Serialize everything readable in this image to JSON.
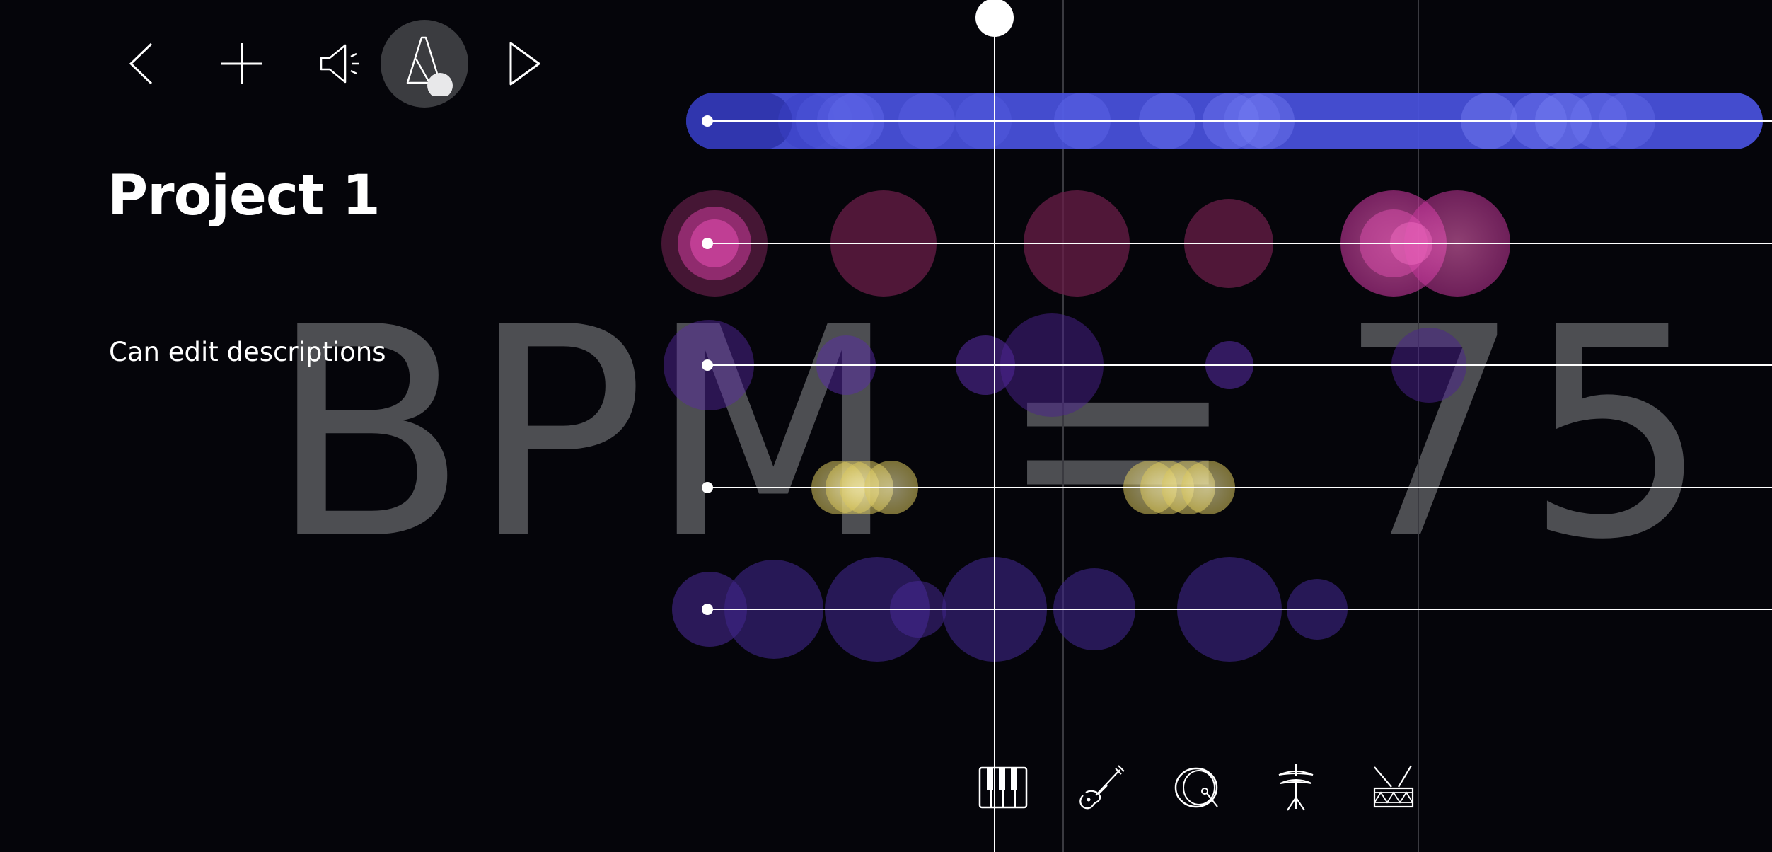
{
  "toolbar": {
    "back_icon": "chevron-left-icon",
    "add_icon": "plus-icon",
    "sound_icon": "speaker-icon",
    "metronome_icon": "metronome-icon",
    "play_icon": "play-icon"
  },
  "project": {
    "title": "Project 1",
    "description": "Can edit descriptions"
  },
  "tempo": {
    "bpm_display": "BPM = 75",
    "bpm": 75
  },
  "instruments": [
    {
      "name": "piano",
      "icon": "piano-icon"
    },
    {
      "name": "guitar",
      "icon": "guitar-icon"
    },
    {
      "name": "bass-drum",
      "icon": "bass-drum-icon"
    },
    {
      "name": "cymbal",
      "icon": "cymbal-icon"
    },
    {
      "name": "snare",
      "icon": "snare-drum-icon"
    }
  ],
  "colors": {
    "background": "#05050a",
    "piano_track": "#4a52e0",
    "guitar_notes": "#e04aa8",
    "bass_notes": "#5a2ba8",
    "cymbal_notes": "#f3e487",
    "snare_notes": "#4a2a9a",
    "playhead": "#ffffff"
  },
  "tracks": [
    {
      "name": "piano",
      "notes": [
        {
          "radius": 40,
          "opacity": 0.5
        }
      ]
    },
    {
      "name": "guitar",
      "notes": [
        {
          "radius": 75,
          "opacity": 0.55
        },
        {
          "radius": 75,
          "opacity": 0.45
        },
        {
          "radius": 75,
          "opacity": 0.45
        },
        {
          "radius": 63,
          "opacity": 0.45
        },
        {
          "radius": 75,
          "opacity": 0.6
        },
        {
          "radius": 75,
          "opacity": 0.6
        }
      ]
    },
    {
      "name": "bass",
      "notes": [
        {
          "radius": 64,
          "opacity": 0.45
        },
        {
          "radius": 42,
          "opacity": 0.5
        },
        {
          "radius": 42,
          "opacity": 0.55
        },
        {
          "radius": 73,
          "opacity": 0.5
        },
        {
          "radius": 34,
          "opacity": 0.55
        },
        {
          "radius": 53,
          "opacity": 0.5
        }
      ]
    },
    {
      "name": "cymbal",
      "notes": [
        {
          "radius": 38,
          "opacity": 0.55
        },
        {
          "radius": 38,
          "opacity": 0.55
        },
        {
          "radius": 38,
          "opacity": 0.55
        },
        {
          "radius": 38,
          "opacity": 0.55
        },
        {
          "radius": 38,
          "opacity": 0.55
        },
        {
          "radius": 38,
          "opacity": 0.55
        },
        {
          "radius": 38,
          "opacity": 0.55
        }
      ]
    },
    {
      "name": "snare",
      "notes": [
        {
          "radius": 53,
          "opacity": 0.55
        },
        {
          "radius": 70,
          "opacity": 0.55
        },
        {
          "radius": 74,
          "opacity": 0.55
        },
        {
          "radius": 40,
          "opacity": 0.5
        },
        {
          "radius": 74,
          "opacity": 0.55
        },
        {
          "radius": 58,
          "opacity": 0.55
        },
        {
          "radius": 74,
          "opacity": 0.55
        },
        {
          "radius": 43,
          "opacity": 0.55
        }
      ]
    }
  ]
}
